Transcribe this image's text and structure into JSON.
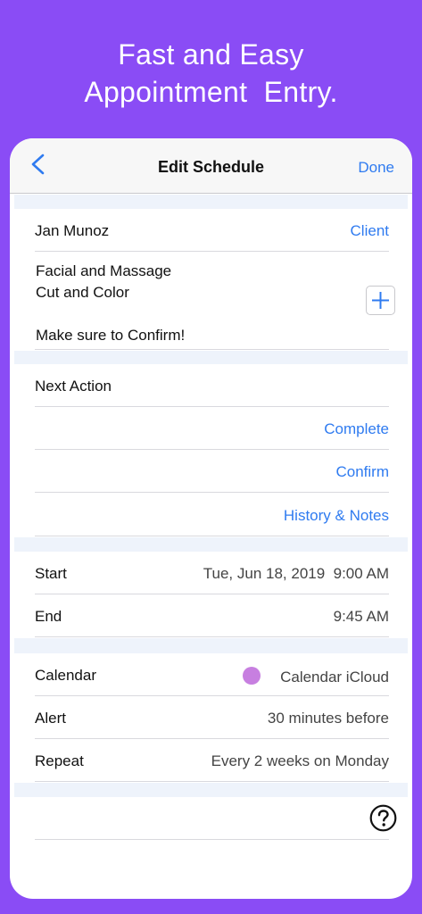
{
  "promo": {
    "line1": "Fast and Easy",
    "line2": "Appointment  Entry."
  },
  "navbar": {
    "back_icon": "chevron-left-icon",
    "title": "Edit Schedule",
    "done_label": "Done"
  },
  "client": {
    "name": "Jan  Munoz",
    "action_label": "Client"
  },
  "notes": {
    "line1": "Facial and Massage",
    "line2": "Cut and Color",
    "line3": "Make sure to Confirm!",
    "add_icon": "plus-icon"
  },
  "actions": {
    "header": "Next Action",
    "complete": "Complete",
    "confirm": "Confirm",
    "history": "History & Notes"
  },
  "time": {
    "start_label": "Start",
    "start_value": "Tue, Jun 18, 2019  9:00 AM",
    "end_label": "End",
    "end_value": "9:45 AM"
  },
  "settings": {
    "calendar_label": "Calendar",
    "calendar_value": "Calendar iCloud",
    "calendar_color": "#c77fe0",
    "alert_label": "Alert",
    "alert_value": "30 minutes before",
    "repeat_label": "Repeat",
    "repeat_value": "Every 2 weeks on Monday"
  },
  "footer": {
    "help_icon": "question-circle-icon"
  },
  "colors": {
    "background": "#8a4cf5",
    "accent": "#2f7bf0"
  }
}
